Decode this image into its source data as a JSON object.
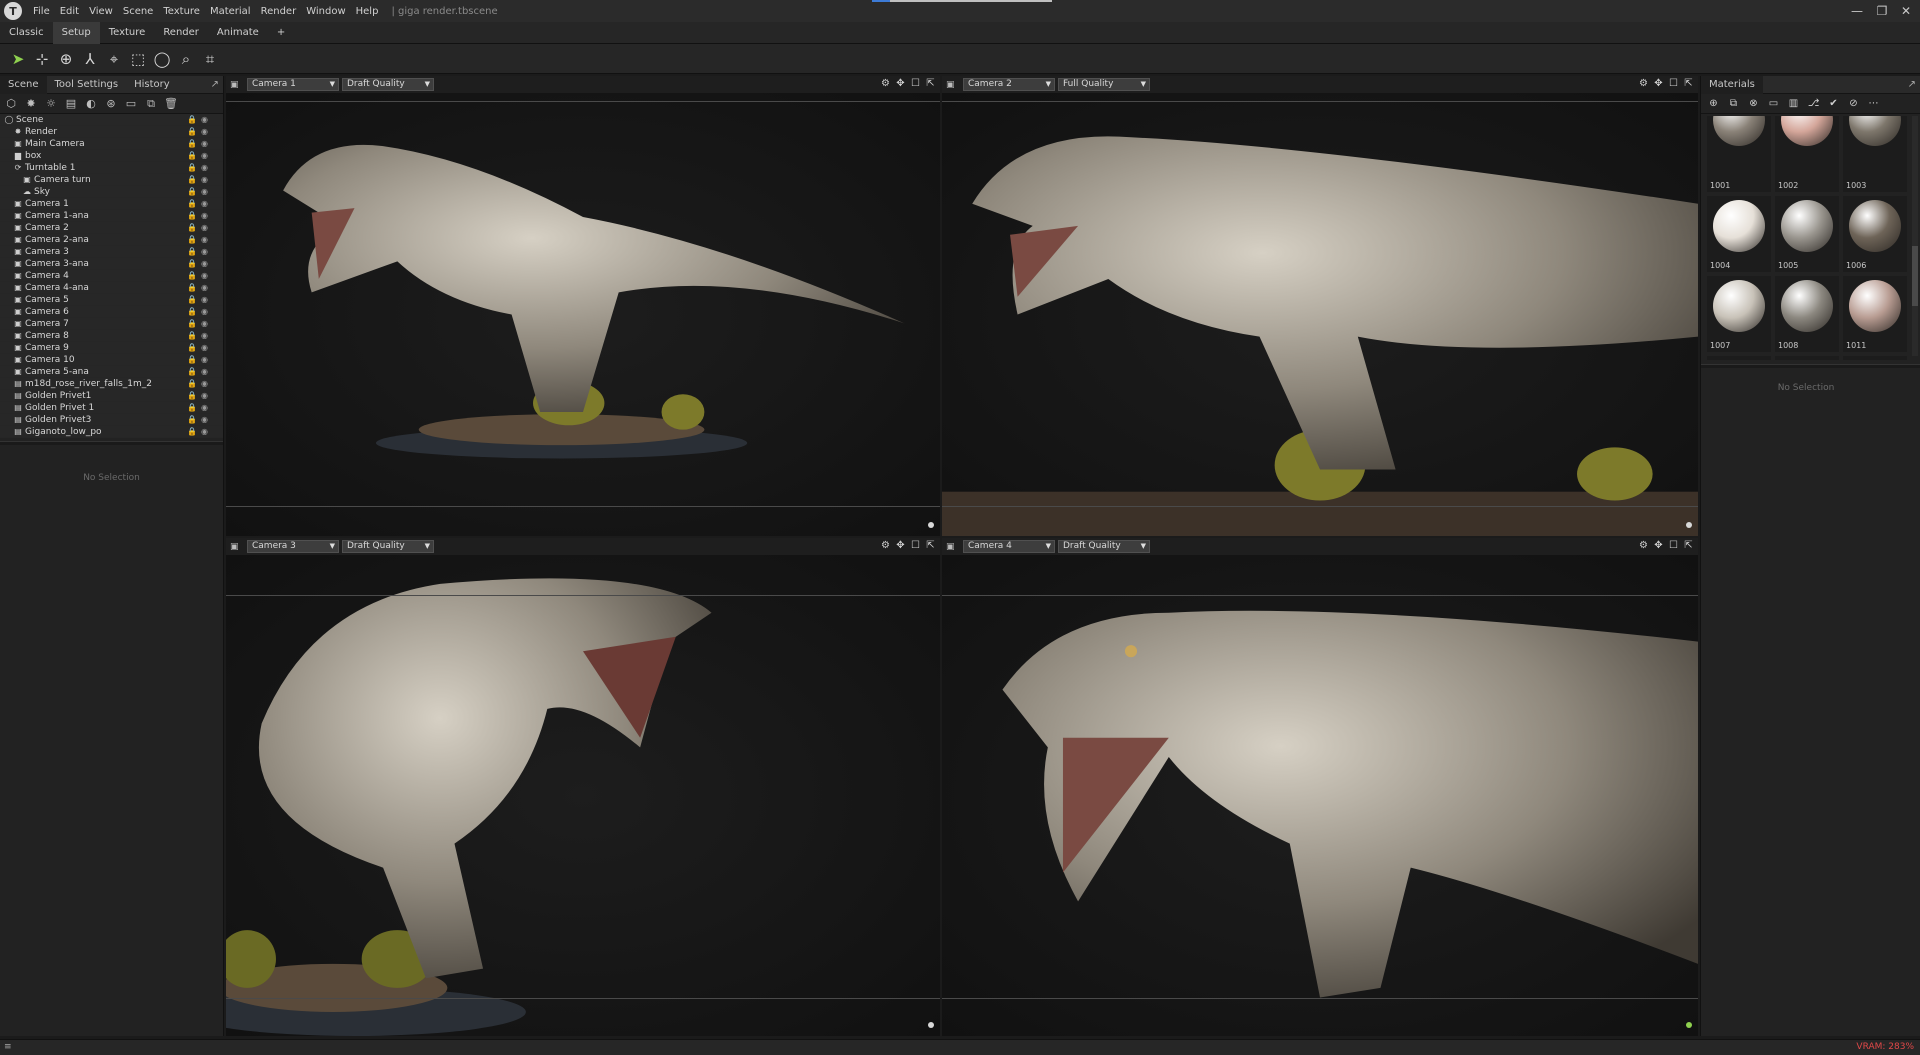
{
  "app": {
    "logo_letter": "T",
    "menu": [
      "File",
      "Edit",
      "View",
      "Scene",
      "Texture",
      "Material",
      "Render",
      "Window",
      "Help"
    ],
    "doc_title": "| giga render.tbscene",
    "title_progress": 0.1,
    "window_controls": [
      "—",
      "❐",
      "✕"
    ]
  },
  "workspace_tabs": [
    {
      "label": "Classic",
      "active": false
    },
    {
      "label": "Setup",
      "active": true
    },
    {
      "label": "Texture",
      "active": false
    },
    {
      "label": "Render",
      "active": false
    },
    {
      "label": "Animate",
      "active": false
    },
    {
      "label": "+",
      "active": false
    }
  ],
  "toolbar": {
    "tools": [
      {
        "name": "select-tool-icon",
        "glyph": "➤",
        "active": true
      },
      {
        "name": "move-tool-icon",
        "glyph": "⊹",
        "active": false
      },
      {
        "name": "rotate-tool-icon",
        "glyph": "⊕",
        "active": false
      },
      {
        "name": "scale-tool-icon",
        "glyph": "⅄",
        "active": false
      },
      {
        "name": "turntable-tool-icon",
        "glyph": "⌖",
        "active": false
      },
      {
        "name": "rect-select-icon",
        "glyph": "⬚",
        "active": false
      },
      {
        "name": "circle-select-icon",
        "glyph": "◯",
        "active": false
      },
      {
        "name": "lasso-select-icon",
        "glyph": "⌕",
        "active": false
      },
      {
        "name": "polygon-select-icon",
        "glyph": "⌗",
        "active": false
      }
    ]
  },
  "left_panel": {
    "tabs": [
      {
        "label": "Scene",
        "active": true
      },
      {
        "label": "Tool Settings",
        "active": false
      },
      {
        "label": "History",
        "active": false
      }
    ],
    "undock_icon": "↗",
    "tools": [
      "⬡",
      "✸",
      "☼",
      "▤",
      "◐",
      "⊛",
      "▭",
      "⧉",
      "🗑"
    ],
    "tree": [
      {
        "label": "Scene",
        "icon": "◯",
        "indent": 0
      },
      {
        "label": "Render",
        "icon": "✸",
        "indent": 1
      },
      {
        "label": "Main Camera",
        "icon": "▣",
        "indent": 1
      },
      {
        "label": "box",
        "icon": "▆",
        "indent": 1
      },
      {
        "label": "Turntable 1",
        "icon": "⟳",
        "indent": 1
      },
      {
        "label": "Camera turn",
        "icon": "▣",
        "indent": 2
      },
      {
        "label": "Sky",
        "icon": "☁",
        "indent": 2
      },
      {
        "label": "Camera 1",
        "icon": "▣",
        "indent": 1
      },
      {
        "label": "Camera 1-ana",
        "icon": "▣",
        "indent": 1
      },
      {
        "label": "Camera 2",
        "icon": "▣",
        "indent": 1
      },
      {
        "label": "Camera 2-ana",
        "icon": "▣",
        "indent": 1
      },
      {
        "label": "Camera 3",
        "icon": "▣",
        "indent": 1
      },
      {
        "label": "Camera 3-ana",
        "icon": "▣",
        "indent": 1
      },
      {
        "label": "Camera 4",
        "icon": "▣",
        "indent": 1
      },
      {
        "label": "Camera 4-ana",
        "icon": "▣",
        "indent": 1
      },
      {
        "label": "Camera 5",
        "icon": "▣",
        "indent": 1
      },
      {
        "label": "Camera 6",
        "icon": "▣",
        "indent": 1
      },
      {
        "label": "Camera 7",
        "icon": "▣",
        "indent": 1
      },
      {
        "label": "Camera 8",
        "icon": "▣",
        "indent": 1
      },
      {
        "label": "Camera 9",
        "icon": "▣",
        "indent": 1
      },
      {
        "label": "Camera 10",
        "icon": "▣",
        "indent": 1
      },
      {
        "label": "Camera 5-ana",
        "icon": "▣",
        "indent": 1
      },
      {
        "label": "m18d_rose_river_falls_1m_2",
        "icon": "▤",
        "indent": 1
      },
      {
        "label": "Golden Privet1",
        "icon": "▤",
        "indent": 1
      },
      {
        "label": "Golden Privet 1",
        "icon": "▤",
        "indent": 1
      },
      {
        "label": "Golden Privet3",
        "icon": "▤",
        "indent": 1
      },
      {
        "label": "Giganoto_low_po",
        "icon": "▤",
        "indent": 1
      }
    ],
    "no_selection": "No Selection"
  },
  "viewports": [
    {
      "camera": "Camera 1",
      "quality": "Draft Quality",
      "scene": "side"
    },
    {
      "camera": "Camera 2",
      "quality": "Full Quality",
      "scene": "closeup"
    },
    {
      "camera": "Camera 3",
      "quality": "Draft Quality",
      "scene": "front"
    },
    {
      "camera": "Camera 4",
      "quality": "Draft Quality",
      "scene": "head"
    }
  ],
  "viewport_controls": [
    "⚙",
    "✥",
    "☐",
    "⇱"
  ],
  "right_panel": {
    "tab": "Materials",
    "undock_icon": "↗",
    "tools": [
      "⊕",
      "⧉",
      "⊗",
      "▭",
      "▥",
      "⎇",
      "✔",
      "⊘",
      "⋯"
    ],
    "materials": [
      {
        "label": "1001",
        "color": "#8a8278"
      },
      {
        "label": "1002",
        "color": "#d4a69a"
      },
      {
        "label": "1003",
        "color": "#7e776c"
      },
      {
        "label": "1004",
        "color": "#e6e0d8"
      },
      {
        "label": "1005",
        "color": "#9a968f"
      },
      {
        "label": "1006",
        "color": "#6e6458"
      },
      {
        "label": "1007",
        "color": "#c8c2b8"
      },
      {
        "label": "1008",
        "color": "#8c8880"
      },
      {
        "label": "1011",
        "color": "#b89c92"
      },
      {
        "label": "",
        "color": "#d8b4a8"
      },
      {
        "label": "",
        "color": "#a8a298"
      },
      {
        "label": "",
        "color": "#bdb7ae"
      }
    ],
    "no_selection": "No Selection"
  },
  "status": {
    "icon": "≡",
    "vram": "VRAM: 283%"
  },
  "colors": {
    "accent": "#8fd14f",
    "warning": "#e04848"
  }
}
